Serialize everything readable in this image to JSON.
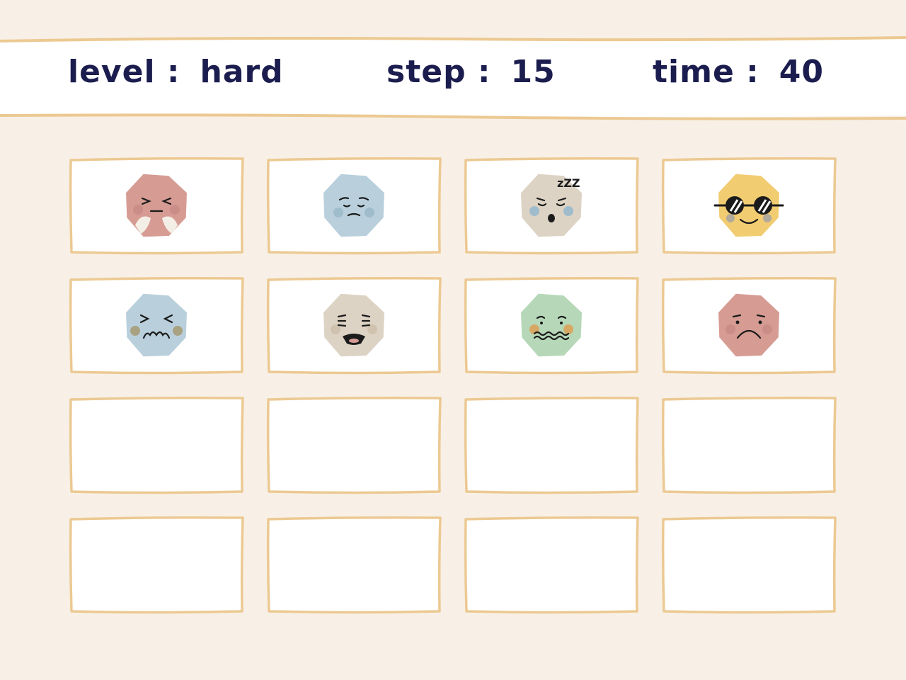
{
  "hud": {
    "level_label": "level :",
    "level_value": "hard",
    "step_label": "step :",
    "step_value": "15",
    "time_label": "time :",
    "time_value": "40"
  },
  "colors": {
    "background": "#f8f0e7",
    "card_border": "#ecc992",
    "text": "#1c1d4f"
  },
  "cards": [
    {
      "face": "angry-steam",
      "fill": "#d69c94",
      "face_up": true
    },
    {
      "face": "worried",
      "fill": "#b9d0dc",
      "face_up": true
    },
    {
      "face": "sleepy",
      "fill": "#ddd3c5",
      "face_up": true,
      "label": "zZZ"
    },
    {
      "face": "cool-sunglasses",
      "fill": "#f2cc71",
      "face_up": true
    },
    {
      "face": "squint-grimace",
      "fill": "#b9d0dc",
      "face_up": true
    },
    {
      "face": "scared",
      "fill": "#ddd3c5",
      "face_up": true
    },
    {
      "face": "nauseous",
      "fill": "#b6d8b8",
      "face_up": true
    },
    {
      "face": "sad",
      "fill": "#d69c94",
      "face_up": true
    },
    {
      "face": "hidden",
      "face_up": false
    },
    {
      "face": "hidden",
      "face_up": false
    },
    {
      "face": "hidden",
      "face_up": false
    },
    {
      "face": "hidden",
      "face_up": false
    },
    {
      "face": "hidden",
      "face_up": false
    },
    {
      "face": "hidden",
      "face_up": false
    },
    {
      "face": "hidden",
      "face_up": false
    },
    {
      "face": "hidden",
      "face_up": false
    }
  ]
}
